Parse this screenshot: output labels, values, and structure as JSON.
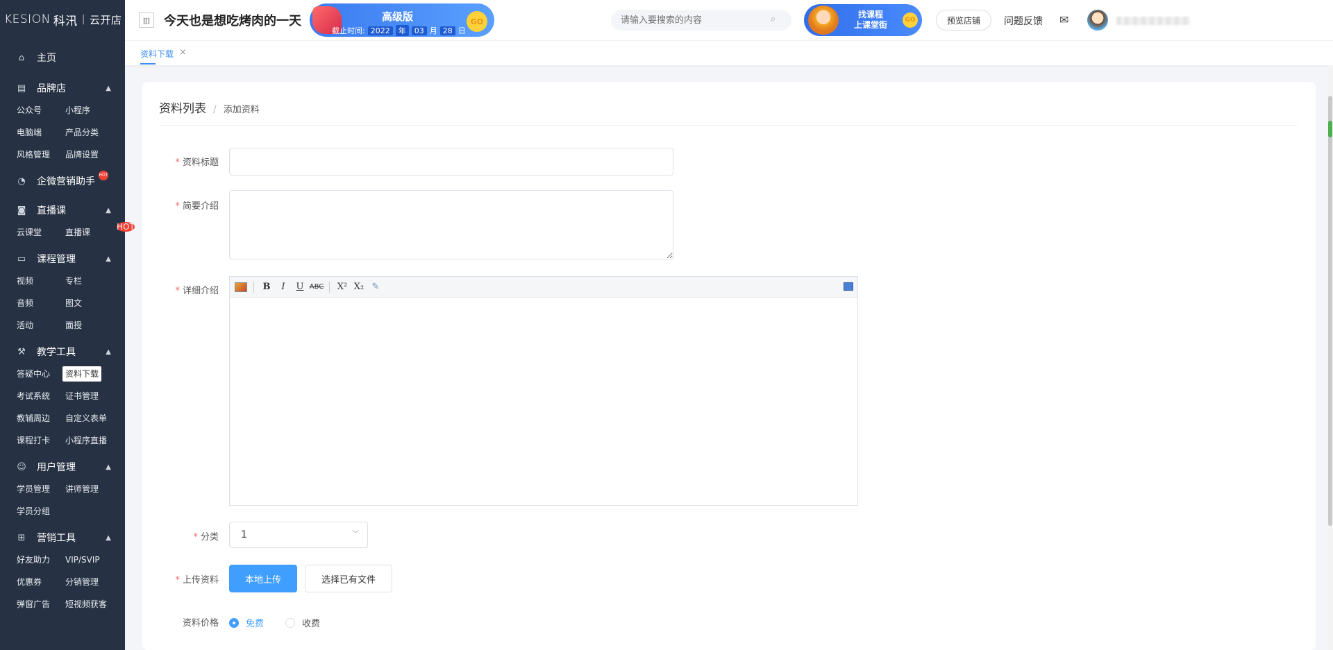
{
  "app": {
    "brand": "KESION",
    "brand_cn": "科汛",
    "product": "云开店",
    "shop_name": "今天也是想吃烤肉的一天"
  },
  "promo": {
    "edition": "高级版",
    "expiry_label": "截止时间:",
    "year": "2022",
    "year_unit": "年",
    "month": "03",
    "month_unit": "月",
    "day": "28",
    "day_unit": "日",
    "go": "GO"
  },
  "header": {
    "search_placeholder": "请输入要搜索的内容",
    "course_banner_line1": "找课程",
    "course_banner_line2": "上课堂街",
    "course_go": "GO",
    "preview_shop": "预览店铺",
    "feedback": "问题反馈"
  },
  "sidebar": {
    "home": "主页",
    "brand_store": {
      "title": "品牌店",
      "items": [
        "公众号",
        "小程序",
        "电脑端",
        "产品分类",
        "风格管理",
        "品牌设置"
      ]
    },
    "wecom": "企微营销助手",
    "live": {
      "title": "直播课",
      "items": [
        "云课堂",
        "直播课"
      ]
    },
    "course_mgmt": {
      "title": "课程管理",
      "items": [
        "视频",
        "专栏",
        "音频",
        "图文",
        "活动",
        "面授"
      ]
    },
    "teaching_tools": {
      "title": "教学工具",
      "items": [
        "答疑中心",
        "资料下载",
        "考试系统",
        "证书管理",
        "教辅周边",
        "自定义表单",
        "课程打卡",
        "小程序直播"
      ]
    },
    "user_mgmt": {
      "title": "用户管理",
      "items": [
        "学员管理",
        "讲师管理",
        "学员分组"
      ]
    },
    "marketing": {
      "title": "营销工具",
      "items": [
        "好友助力",
        "VIP/SVIP",
        "优惠券",
        "分销管理",
        "弹窗广告",
        "短视频获客"
      ]
    },
    "hot_badge": "HOT"
  },
  "tabs": {
    "active_tab": "资料下载"
  },
  "breadcrumb": {
    "parent": "资料列表",
    "separator": "/",
    "current": "添加资料"
  },
  "form": {
    "title_label": "资料标题",
    "title_value": "",
    "intro_label": "简要介绍",
    "intro_value": "",
    "detail_label": "详细介绍",
    "category_label": "分类",
    "category_value": "1",
    "upload_label": "上传资料",
    "upload_local": "本地上传",
    "upload_existing": "选择已有文件",
    "price_label": "资料价格",
    "price_free": "免费",
    "price_paid": "收费"
  },
  "colors": {
    "sidebar_bg": "#263243",
    "primary": "#409eff",
    "required": "#f56c6c"
  }
}
